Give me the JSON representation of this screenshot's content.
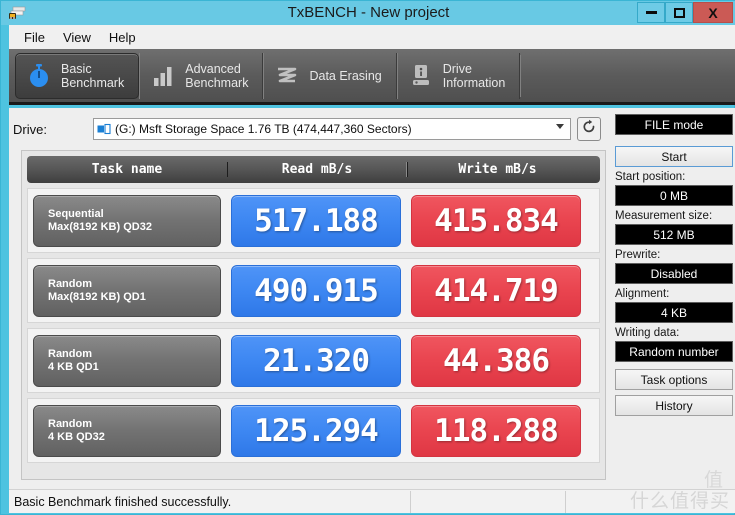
{
  "window": {
    "title": "TxBENCH - New project",
    "app_icon": "benchmark-app-icon",
    "buttons": {
      "minimize": "minimize-icon",
      "maximize": "maximize-icon",
      "close": "X"
    },
    "accent_color": "#4ec3e0",
    "close_color": "#cb5a55"
  },
  "menu": {
    "items": [
      {
        "label": "File"
      },
      {
        "label": "View"
      },
      {
        "label": "Help"
      }
    ]
  },
  "tabs": [
    {
      "label": "Basic\nBenchmark",
      "icon": "stopwatch-icon",
      "active": true
    },
    {
      "label": "Advanced\nBenchmark",
      "icon": "bar-chart-icon",
      "active": false
    },
    {
      "label": "Data Erasing",
      "icon": "shred-waves-icon",
      "active": false
    },
    {
      "label": "Drive\nInformation",
      "icon": "drive-info-icon",
      "active": false
    }
  ],
  "drive": {
    "label": "Drive:",
    "selected": "(G:) Msft Storage Space  1.76 TB (474,447,360 Sectors)",
    "icon": "hard-drive-icon",
    "refresh_icon": "refresh-icon"
  },
  "results": {
    "headers": [
      "Task name",
      "Read mB/s",
      "Write mB/s"
    ],
    "rows": [
      {
        "name_line1": "Sequential",
        "name_line2": "Max(8192 KB) QD32",
        "read": "517.188",
        "write": "415.834"
      },
      {
        "name_line1": "Random",
        "name_line2": "Max(8192 KB) QD1",
        "read": "490.915",
        "write": "414.719"
      },
      {
        "name_line1": "Random",
        "name_line2": "4 KB QD1",
        "read": "21.320",
        "write": "44.386"
      },
      {
        "name_line1": "Random",
        "name_line2": "4 KB QD32",
        "read": "125.294",
        "write": "118.288"
      }
    ],
    "read_color": "#3d87f2",
    "write_color": "#e9444f"
  },
  "sidebar": {
    "mode_readout": "FILE mode",
    "start_button": "Start",
    "start_position_label": "Start position:",
    "start_position_value": "0 MB",
    "measurement_size_label": "Measurement size:",
    "measurement_size_value": "512 MB",
    "prewrite_label": "Prewrite:",
    "prewrite_value": "Disabled",
    "alignment_label": "Alignment:",
    "alignment_value": "4 KB",
    "writing_data_label": "Writing data:",
    "writing_data_value": "Random number",
    "task_options_button": "Task options",
    "history_button": "History"
  },
  "statusbar": {
    "message": "Basic Benchmark finished successfully.",
    "pane2": "",
    "pane3": ""
  },
  "watermark": {
    "text": "什么值得买",
    "text_mid": "值"
  }
}
